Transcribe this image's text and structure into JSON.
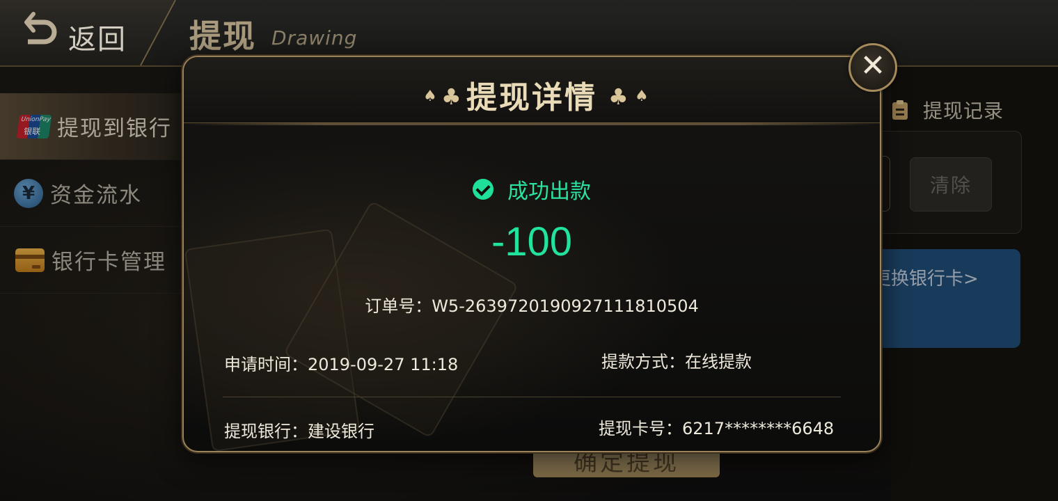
{
  "header": {
    "back_label": "返回",
    "title": "提现",
    "subtitle": "Drawing"
  },
  "sidebar": {
    "items": [
      {
        "label": "提现到银行",
        "icon": "unionpay-icon",
        "active": true
      },
      {
        "label": "资金流水",
        "icon": "yen-coin-icon",
        "active": false
      },
      {
        "label": "银行卡管理",
        "icon": "bank-card-icon",
        "active": false
      }
    ],
    "unionpay_text_top": "UnionPay",
    "unionpay_text_bottom": "银联",
    "yen_symbol": "¥"
  },
  "right_panel": {
    "records_label": "提现记录",
    "clear_label": "清除",
    "change_card_label": "更换银行卡>"
  },
  "confirm_button_label": "确定提现",
  "modal": {
    "title": "提现详情",
    "status": "成功出款",
    "amount": "-100",
    "order_no": "订单号：W5-2639720190927111810504",
    "apply_time": "申请时间：2019-09-27 11:18",
    "method": "提款方式：在线提款",
    "bank": "提现银行：建设银行",
    "card_no": "提现卡号：6217********6648",
    "close_symbol": "✕"
  },
  "colors": {
    "accent_gold": "#9c8258",
    "success_green": "#22e39d",
    "change_card_bg": "#224f7a"
  }
}
